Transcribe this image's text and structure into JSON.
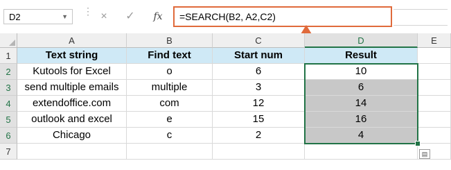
{
  "name_box": "D2",
  "formula_bar": {
    "cancel_icon": "×",
    "enter_icon": "✓",
    "fx_label": "fx",
    "formula": "=SEARCH(B2, A2,C2)"
  },
  "columns": [
    "A",
    "B",
    "C",
    "D",
    "E"
  ],
  "rows": [
    "1",
    "2",
    "3",
    "4",
    "5",
    "6",
    "7"
  ],
  "table": {
    "headers": [
      "Text  string",
      "Find text",
      "Start num",
      "Result"
    ],
    "data": [
      [
        "Kutools for Excel",
        "o",
        "6",
        "10"
      ],
      [
        "send multiple emails",
        "multiple",
        "3",
        "6"
      ],
      [
        "extendoffice.com",
        "com",
        "12",
        "14"
      ],
      [
        "outlook and excel",
        "e",
        "15",
        "16"
      ],
      [
        "Chicago",
        "c",
        "2",
        "4"
      ]
    ]
  },
  "colors": {
    "header_fill": "#cfe9f6",
    "result_fill": "#c8c8c8",
    "selection": "#217346",
    "callout_arrow": "#e06a3b"
  },
  "icons": [
    "chevron-down-icon",
    "close-icon",
    "checkmark-icon",
    "function-icon",
    "up-arrow-icon",
    "quick-analysis-icon"
  ]
}
